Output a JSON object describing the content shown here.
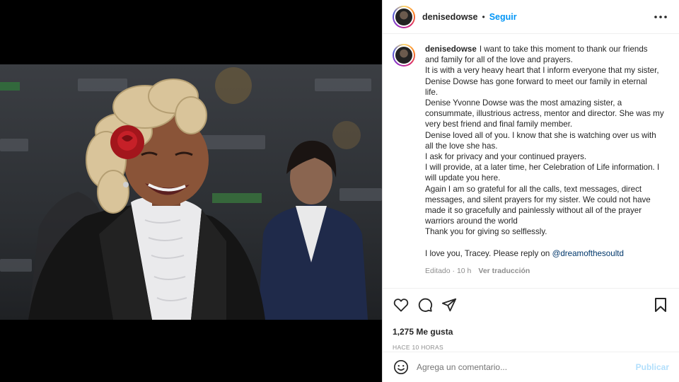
{
  "post": {
    "username": "denisedowse",
    "separator": "•",
    "follow_label": "Seguir"
  },
  "caption": {
    "username": "denisedowse",
    "lines": [
      "I want to take this moment to thank our friends",
      "and family for all of the love and prayers.",
      "It is with a very heavy heart that I inform everyone that my sister,",
      "Denise Dowse has gone forward to meet our family in eternal",
      "life.",
      "Denise Yvonne Dowse was the most amazing sister, a",
      "consummate, illustrious actress, mentor and director. She was my",
      "very best friend and final family member.",
      "Denise loved all of you. I know that she is watching over us with",
      "all the love she has.",
      "I ask for privacy and your continued prayers.",
      "I will provide, at a later time, her Celebration of Life information. I",
      "will update you here.",
      "Again I am so grateful for all the calls, text messages, direct",
      "messages, and silent prayers for my sister. We could not have",
      "made it so gracefully and painlessly without all of the prayer",
      "warriors around the world",
      "Thank you for giving so selflessly."
    ],
    "closing_text": "I love you, Tracey. Please reply on ",
    "mention": "@dreamofthesoultd",
    "edited": "Editado · 10 h",
    "translate_label": "Ver traducción"
  },
  "actions": {
    "icons": [
      "heart-icon",
      "comment-icon",
      "share-icon",
      "bookmark-icon"
    ],
    "likes": "1,275 Me gusta",
    "time": "HACE 10 HORAS"
  },
  "comment_box": {
    "placeholder": "Agrega un comentario...",
    "publish_label": "Publicar"
  },
  "colors": {
    "accent": "#0095f6",
    "mention": "#00376b",
    "muted": "#8e8e8e",
    "publish_disabled": "#b2dffc"
  }
}
